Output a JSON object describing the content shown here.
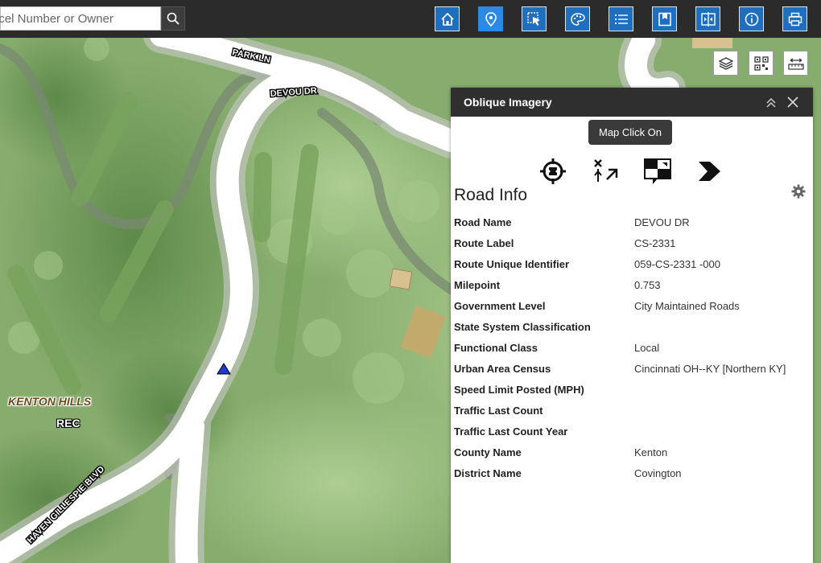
{
  "search": {
    "placeholder": "Parcel Number or Owner"
  },
  "toolbar": {
    "buttons": [
      "home-icon",
      "location-pin-icon",
      "select-tool-icon",
      "basemap-palette-icon",
      "list-icon",
      "bookmark-icon",
      "swipe-compare-icon",
      "info-icon",
      "print-icon"
    ],
    "active": "location-pin-icon",
    "accent": "#1f6fc0"
  },
  "map": {
    "roads": [
      "PARK LN",
      "DEVOU DR",
      "HAVEN GILLESPIE BLVD"
    ],
    "places": {
      "neighborhood": "KENTON HILLS",
      "rec": "REC"
    }
  },
  "panel": {
    "title": "Oblique Imagery",
    "tooltip": "Map Click On",
    "section_title": "Road Info",
    "rows": [
      {
        "label": "Road Name",
        "value": "DEVOU DR"
      },
      {
        "label": "Route Label",
        "value": "CS-2331"
      },
      {
        "label": "Route Unique Identifier",
        "value": "059-CS-2331 -000"
      },
      {
        "label": "Milepoint",
        "value": "0.753"
      },
      {
        "label": "Government Level",
        "value": "City Maintained Roads"
      },
      {
        "label": "State System Classification",
        "value": ""
      },
      {
        "label": "Functional Class",
        "value": "Local"
      },
      {
        "label": "Urban Area Census",
        "value": "Cincinnati OH--KY [Northern KY]"
      },
      {
        "label": "Speed Limit Posted (MPH)",
        "value": ""
      },
      {
        "label": "Traffic Last Count",
        "value": ""
      },
      {
        "label": "Traffic Last Count Year",
        "value": ""
      },
      {
        "label": "County Name",
        "value": "Kenton"
      },
      {
        "label": "District Name",
        "value": "Covington"
      }
    ]
  }
}
